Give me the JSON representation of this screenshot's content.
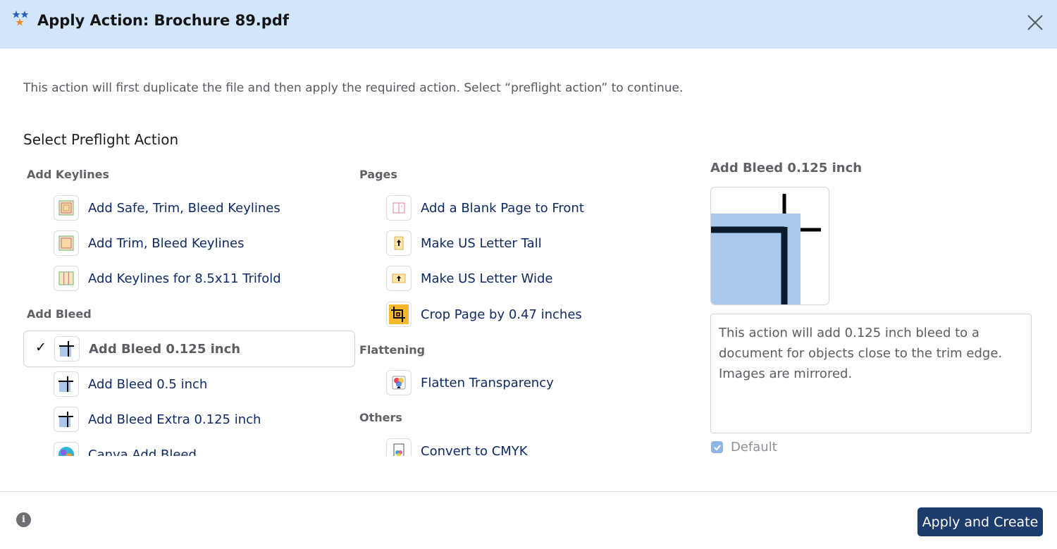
{
  "dialog": {
    "title": "Apply Action: Brochure 89.pdf",
    "intro": "This action will first duplicate the file and then apply the required action. Select “preflight action” to continue.",
    "section_title": "Select Preflight Action"
  },
  "groups": {
    "keylines": {
      "label": "Add Keylines",
      "items": [
        "Add Safe, Trim, Bleed Keylines",
        "Add Trim, Bleed Keylines",
        "Add Keylines for 8.5x11 Trifold"
      ]
    },
    "bleed": {
      "label": "Add Bleed",
      "items": [
        "Add Bleed 0.125 inch",
        "Add Bleed 0.5 inch",
        "Add Bleed Extra 0.125 inch",
        "Canva Add Bleed"
      ],
      "selected_index": 0,
      "check_mark": "✓"
    },
    "pages": {
      "label": "Pages",
      "items": [
        "Add a Blank Page to Front",
        "Make US Letter Tall",
        "Make US Letter Wide",
        "Crop Page by 0.47 inches"
      ]
    },
    "flattening": {
      "label": "Flattening",
      "items": [
        "Flatten Transparency"
      ]
    },
    "others": {
      "label": "Others",
      "items": [
        "Convert to CMYK"
      ]
    }
  },
  "preview": {
    "title": "Add Bleed 0.125 inch",
    "description": "This action will add 0.125 inch bleed to a document for objects close to the trim edge. Images are mirrored.",
    "default_label": "Default",
    "default_checked": true
  },
  "footer": {
    "info_label": "i",
    "apply_label": "Apply and Create"
  },
  "colors": {
    "title_bar": "#d2e5fb",
    "link_text": "#0e2a66",
    "primary_button": "#1d3c6e",
    "bleed_blue": "#aac8ec"
  }
}
